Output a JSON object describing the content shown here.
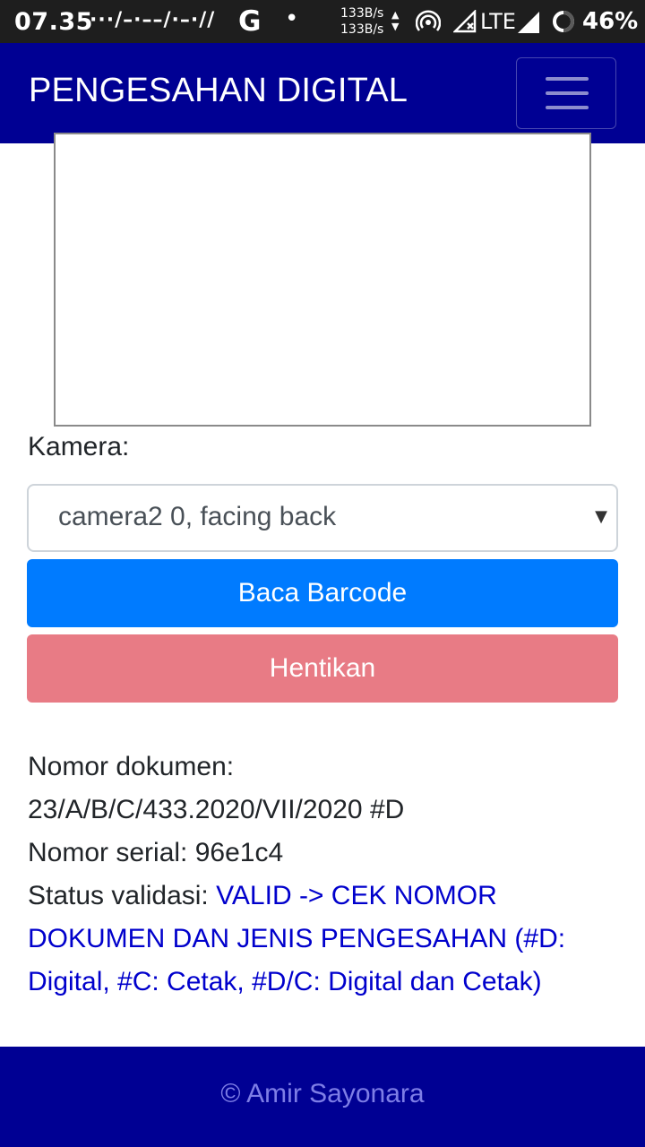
{
  "status_bar": {
    "time": "07.35",
    "notification_glyphs": "···/–·––/·–·//",
    "g_icon": "G",
    "dot": "•",
    "speed_up": "133B/s",
    "speed_down": "133B/s",
    "network": "LTE",
    "battery": "46%"
  },
  "navbar": {
    "brand": "PENGESAHAN DIGITAL",
    "toggler_icon": "hamburger-icon"
  },
  "form": {
    "camera_label": "Kamera:",
    "camera_selected": "camera2 0, facing back",
    "read_button": "Baca Barcode",
    "stop_button": "Hentikan"
  },
  "result": {
    "doc_number_label": "Nomor dokumen:",
    "doc_number_value": "23/A/B/C/433.2020/VII/2020 #D",
    "serial_label": "Nomor serial:",
    "serial_value": "96e1c4",
    "status_label": "Status validasi:",
    "status_value": "VALID -> CEK NOMOR DOKUMEN DAN JENIS PENGESAHAN (#D: Digital, #C: Cetak, #D/C: Digital dan Cetak)"
  },
  "footer": {
    "text": "© Amir Sayonara"
  },
  "colors": {
    "navbar": "#000093",
    "primary": "#007bff",
    "danger": "#e87b85",
    "status_valid": "#0000cc"
  }
}
